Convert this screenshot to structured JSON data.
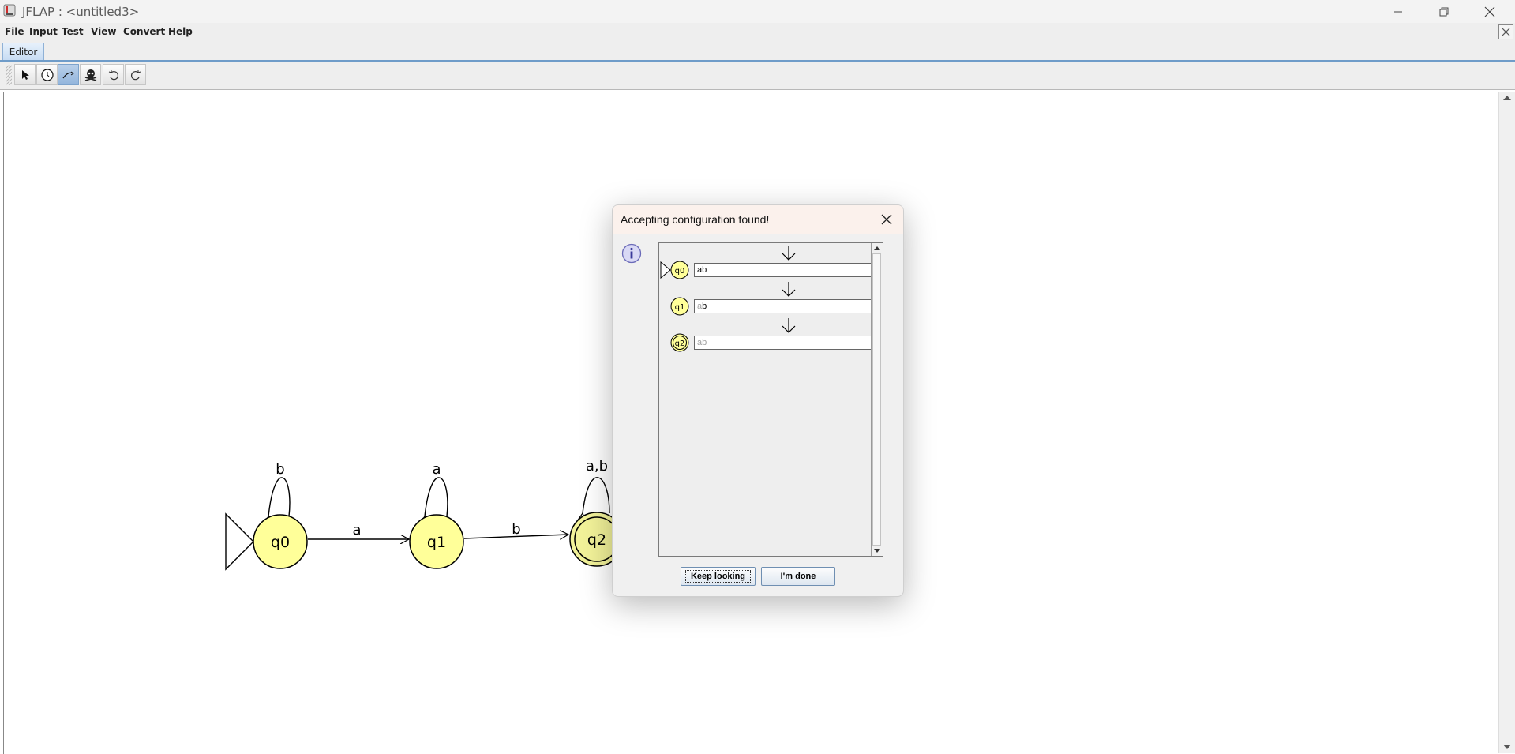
{
  "window": {
    "title": "JFLAP : <untitled3>",
    "controls": {
      "minimize": "minimize-icon",
      "restore": "restore-icon",
      "close": "close-icon"
    }
  },
  "menu": [
    "File",
    "Input",
    "Test",
    "View",
    "Convert",
    "Help"
  ],
  "tabs": [
    {
      "label": "Editor"
    }
  ],
  "toolbar": {
    "tools": [
      {
        "name": "attribute-editor",
        "icon": "arrow-cursor-icon",
        "active": false
      },
      {
        "name": "state-creator",
        "icon": "state-circle-icon",
        "active": false
      },
      {
        "name": "transition-creator",
        "icon": "transition-arrow-icon",
        "active": true
      },
      {
        "name": "deleter",
        "icon": "skull-icon",
        "active": false
      },
      {
        "name": "undo",
        "icon": "undo-icon",
        "active": false
      },
      {
        "name": "redo",
        "icon": "redo-icon",
        "active": false
      }
    ]
  },
  "automaton": {
    "states": [
      {
        "id": "q0",
        "initial": true,
        "final": false,
        "self_loop": "b"
      },
      {
        "id": "q1",
        "initial": false,
        "final": false,
        "self_loop": "a"
      },
      {
        "id": "q2",
        "initial": false,
        "final": true,
        "self_loop": "a,b"
      }
    ],
    "transitions": [
      {
        "from": "q0",
        "to": "q1",
        "label": "a"
      },
      {
        "from": "q1",
        "to": "q2",
        "label": "b"
      }
    ]
  },
  "colors": {
    "state_fill": "#ffff99",
    "tab_accent": "#6f9cc9",
    "dialog_title_bg": "#fbf1ec"
  },
  "dialog": {
    "title": "Accepting configuration found!",
    "icon": "info-icon",
    "configurations": [
      {
        "state": "q0",
        "consumed": "",
        "remaining": "ab",
        "initial": true,
        "final": false
      },
      {
        "state": "q1",
        "consumed": "a",
        "remaining": "b",
        "initial": false,
        "final": false
      },
      {
        "state": "q2",
        "consumed": "ab",
        "remaining": "",
        "initial": false,
        "final": true
      }
    ],
    "buttons": {
      "keep_looking": "Keep looking",
      "done": "I'm done"
    }
  }
}
